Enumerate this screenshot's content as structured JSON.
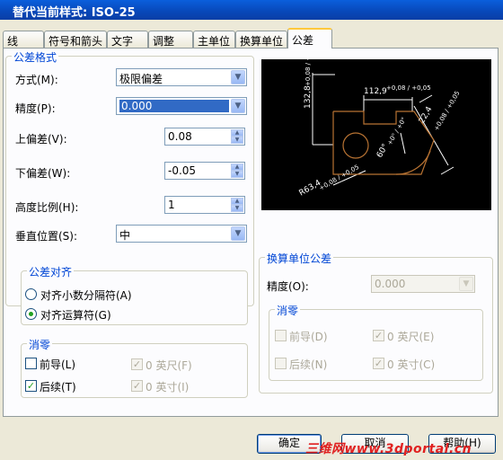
{
  "window": {
    "title": "替代当前样式: ISO-25"
  },
  "tabs": [
    "线",
    "符号和箭头",
    "文字",
    "调整",
    "主单位",
    "换算单位",
    "公差"
  ],
  "tolerance_format": {
    "group_label": "公差格式",
    "method_label": "方式(M):",
    "method_value": "极限偏差",
    "precision_label": "精度(P):",
    "precision_value": "0.000",
    "upper_label": "上偏差(V):",
    "upper_value": "0.08",
    "lower_label": "下偏差(W):",
    "lower_value": "-0.05",
    "height_label": "高度比例(H):",
    "height_value": "1",
    "vpos_label": "垂直位置(S):",
    "vpos_value": "中"
  },
  "alignment": {
    "group_label": "公差对齐",
    "opt1": "对齐小数分隔符(A)",
    "opt2": "对齐运算符(G)",
    "selected": 2
  },
  "zero_suppress": {
    "group_label": "消零",
    "leading": "前导(L)",
    "leading_checked": false,
    "trailing": "后续(T)",
    "trailing_checked": true,
    "feet": "0 英尺(F)",
    "inches": "0 英寸(I)"
  },
  "alt_units": {
    "group_label": "换算单位公差",
    "precision_label": "精度(O):",
    "precision_value": "0.000",
    "zero_label": "消零",
    "leading": "前导(D)",
    "trailing": "后续(N)",
    "feet": "0 英尺(E)",
    "inches": "0 英寸(C)"
  },
  "preview": {
    "dim_vertical": "132,8",
    "dim_vertical_tol": "+0,08 / +0,05",
    "dim_horizontal": "112,9",
    "dim_horizontal_tol": "+0,08 / +0,05",
    "dim_angled": "22,4",
    "dim_angled_tol": "+0,08 / +0,05",
    "dim_angle": "60°",
    "dim_angle_tol": "+0° / +0°",
    "dim_radius": "R63,4",
    "dim_radius_tol": "+0,08 / +0,05"
  },
  "buttons": {
    "ok": "确定",
    "cancel": "取消",
    "help": "帮助(H)"
  },
  "watermark": "三维网www.3dportal.cn",
  "colors": {
    "title_bar": "#0a5fdc",
    "group_label": "#0046d5",
    "selection": "#316ac5",
    "tab_highlight": "#ffc83c",
    "preview_bg": "#000000"
  }
}
